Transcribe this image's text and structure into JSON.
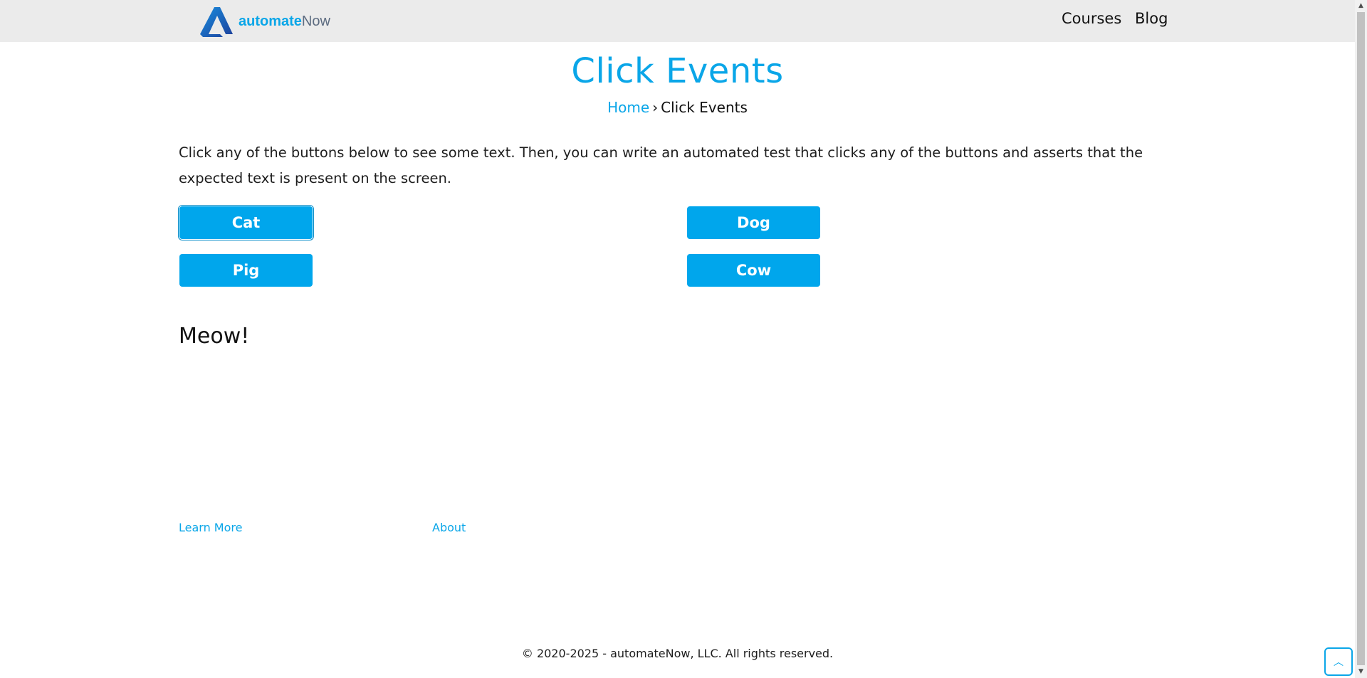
{
  "header": {
    "logo_text_bold": "automate",
    "logo_text_light": "Now",
    "nav": {
      "courses": "Courses",
      "blog": "Blog"
    }
  },
  "page": {
    "title": "Click Events",
    "breadcrumb": {
      "home": "Home",
      "separator": "›",
      "current": "Click Events"
    },
    "intro": "Click any of the buttons below to see some text. Then, you can write an automated test that clicks any of the buttons and asserts that the expected text is present on the screen."
  },
  "buttons": {
    "cat": "Cat",
    "dog": "Dog",
    "pig": "Pig",
    "cow": "Cow"
  },
  "result_text": "Meow!",
  "footer": {
    "learn_more": "Learn More",
    "about": "About",
    "copyright": "© 2020-2025 - automateNow, LLC. All rights reserved."
  },
  "colors": {
    "accent": "#0aa6e8",
    "button": "#00a6ec",
    "header_bg": "#ebebeb"
  },
  "icons": {
    "logo": "automatenow-logo-icon",
    "back_to_top": "chevron-up-icon"
  }
}
